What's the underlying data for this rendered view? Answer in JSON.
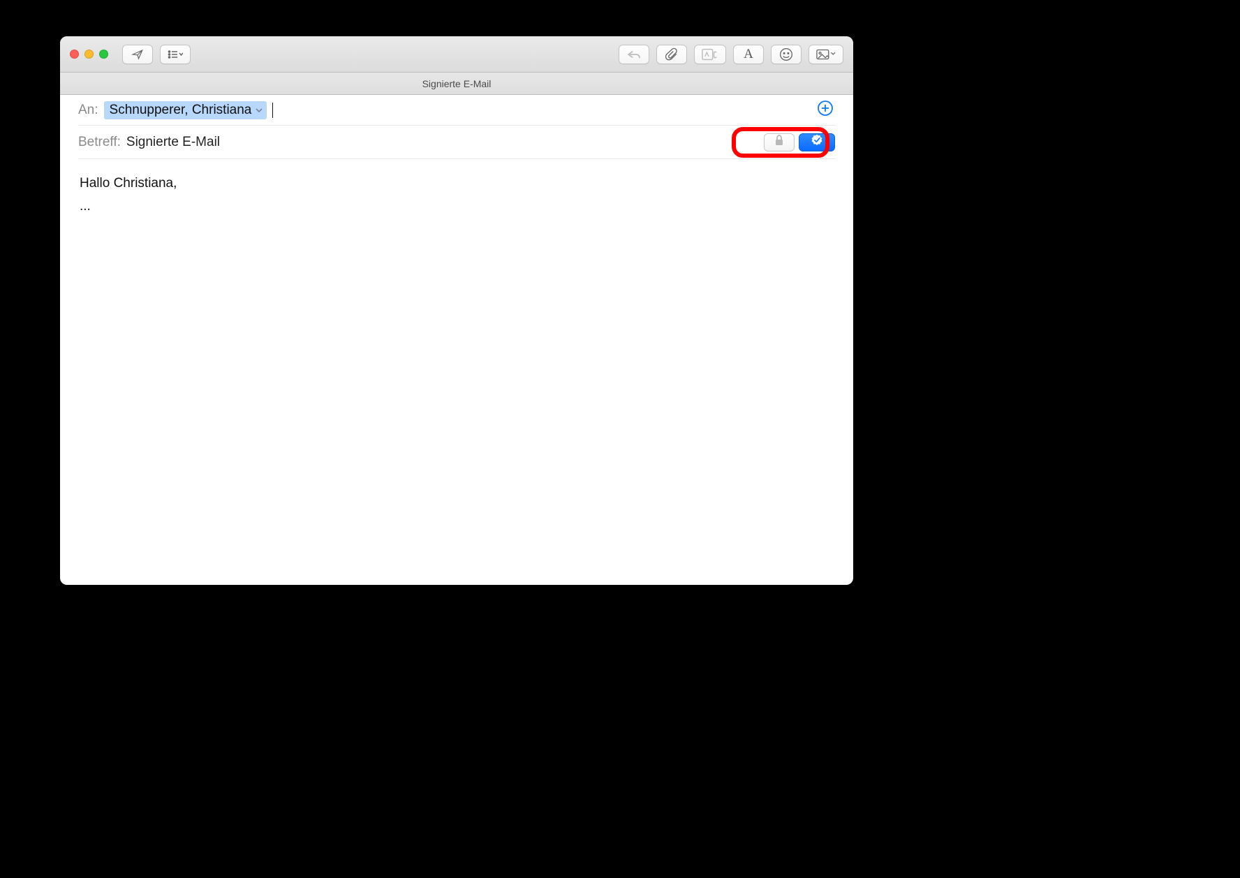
{
  "window": {
    "title": "Signierte E-Mail"
  },
  "fields": {
    "to_label": "An:",
    "to_recipient": "Schnupperer, Christiana",
    "subject_label": "Betreff:",
    "subject_value": "Signierte E-Mail"
  },
  "body": {
    "line1": "Hallo Christiana,",
    "line2": "..."
  },
  "icons": {
    "send": "send-icon",
    "header_menu": "header-menu-icon",
    "reply": "reply-icon",
    "attach": "paperclip-icon",
    "markup": "markup-attach-icon",
    "format": "format-icon",
    "emoji": "emoji-icon",
    "photo": "photo-browser-icon",
    "add_contact": "plus-circle-icon",
    "encrypt": "lock-icon",
    "sign": "signed-badge-icon"
  }
}
